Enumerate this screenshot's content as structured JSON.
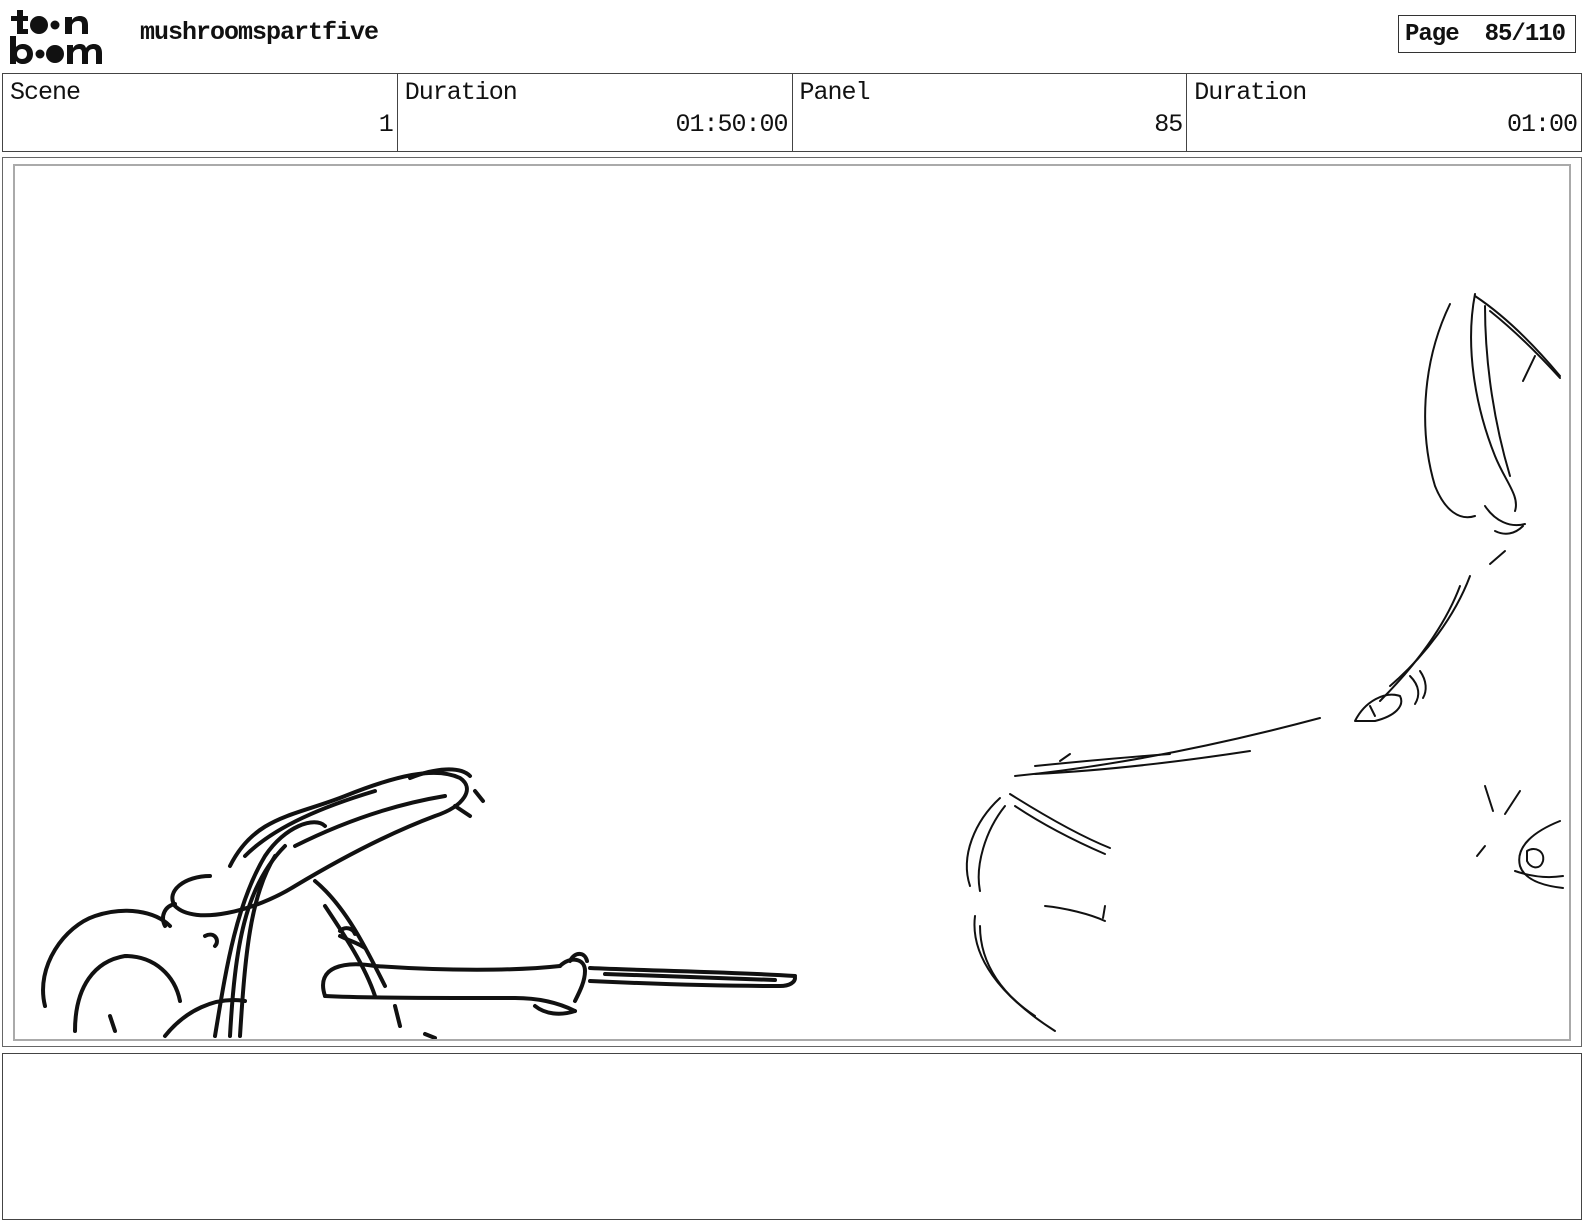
{
  "header": {
    "logo": "toon boom",
    "project_title": "mushroomspartfive",
    "page_label": "Page",
    "page_number": "85/110"
  },
  "info": {
    "scene_label": "Scene",
    "scene_value": "1",
    "scene_duration_label": "Duration",
    "scene_duration_value": "01:50:00",
    "panel_label": "Panel",
    "panel_value": "85",
    "panel_duration_label": "Duration",
    "panel_duration_value": "01:00"
  },
  "panel": {
    "image": "storyboard-sketch"
  },
  "notes": {
    "text": ""
  }
}
